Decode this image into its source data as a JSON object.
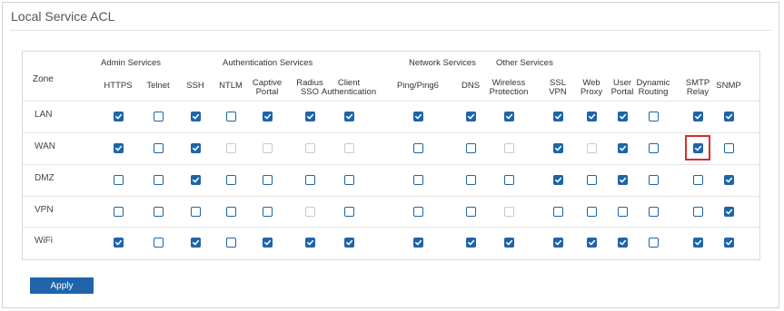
{
  "panel": {
    "title": "Local Service ACL"
  },
  "table": {
    "zone_header": "Zone",
    "groups": [
      "Admin Services",
      "Authentication Services",
      "Network Services",
      "Other Services"
    ],
    "columns": [
      {
        "label": [
          "HTTPS"
        ]
      },
      {
        "label": [
          "Telnet"
        ]
      },
      {
        "label": [
          "SSH"
        ]
      },
      {
        "label": [
          "NTLM"
        ]
      },
      {
        "label": [
          "Captive",
          "Portal"
        ]
      },
      {
        "label": [
          "Radius",
          "SSO"
        ]
      },
      {
        "label": [
          "Client",
          "Authentication"
        ]
      },
      {
        "label": [
          "Ping/Ping6"
        ]
      },
      {
        "label": [
          "DNS"
        ]
      },
      {
        "label": [
          "Wireless",
          "Protection"
        ]
      },
      {
        "label": [
          "SSL",
          "VPN"
        ]
      },
      {
        "label": [
          "Web",
          "Proxy"
        ]
      },
      {
        "label": [
          "User",
          "Portal"
        ]
      },
      {
        "label": [
          "Dynamic",
          "Routing"
        ]
      },
      {
        "label": [
          "SMTP",
          "Relay"
        ]
      },
      {
        "label": [
          "SNMP"
        ]
      }
    ],
    "rows": [
      {
        "zone": "LAN",
        "states": [
          "on",
          "off",
          "on",
          "off",
          "on",
          "on",
          "on",
          "on",
          "on",
          "on",
          "on",
          "on",
          "on",
          "off",
          "on",
          "on"
        ]
      },
      {
        "zone": "WAN",
        "states": [
          "on",
          "off",
          "on",
          "dis",
          "dis",
          "dis",
          "dis",
          "off",
          "off",
          "dis",
          "on",
          "dis",
          "on",
          "off",
          "on",
          "off"
        ]
      },
      {
        "zone": "DMZ",
        "states": [
          "off",
          "off",
          "on",
          "off",
          "off",
          "off",
          "off",
          "off",
          "off",
          "off",
          "on",
          "off",
          "on",
          "off",
          "off",
          "on"
        ]
      },
      {
        "zone": "VPN",
        "states": [
          "off",
          "off",
          "off",
          "off",
          "off",
          "dis",
          "off",
          "off",
          "off",
          "dis",
          "off",
          "off",
          "off",
          "off",
          "off",
          "on"
        ]
      },
      {
        "zone": "WiFi",
        "states": [
          "on",
          "off",
          "on",
          "off",
          "on",
          "on",
          "on",
          "on",
          "on",
          "on",
          "on",
          "on",
          "on",
          "off",
          "on",
          "on"
        ]
      }
    ],
    "highlighted_cell": {
      "row": 1,
      "column": 14
    }
  },
  "actions": {
    "apply_label": "Apply"
  },
  "colors": {
    "accent": "#1f64ab",
    "highlight": "#d32f2f"
  }
}
